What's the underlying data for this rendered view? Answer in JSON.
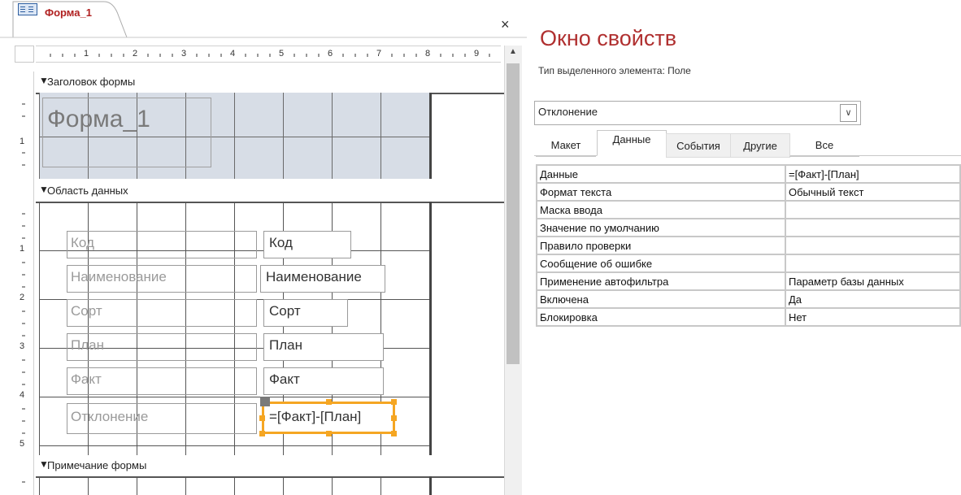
{
  "document_tab": {
    "title": "Форма_1",
    "close": "×"
  },
  "ruler": {
    "h_numbers": [
      "1",
      "2",
      "3",
      "4",
      "5",
      "6",
      "7",
      "8",
      "9"
    ],
    "v_numbers": [
      "1",
      "1",
      "2",
      "3",
      "4",
      "5"
    ]
  },
  "sections": {
    "header": "Заголовок формы",
    "detail": "Область данных",
    "footer": "Примечание формы"
  },
  "form_title": "Форма_1",
  "controls": [
    {
      "label": "Код",
      "field": "Код"
    },
    {
      "label": "Наименование",
      "field": "Наименование"
    },
    {
      "label": "Сорт",
      "field": "Сорт"
    },
    {
      "label": "План",
      "field": "План"
    },
    {
      "label": "Факт",
      "field": "Факт"
    },
    {
      "label": "Отклонение",
      "field": "=[Факт]-[План]"
    }
  ],
  "property_sheet": {
    "title": "Окно свойств",
    "selection_type": "Тип выделенного элемента:  Поле",
    "selected_object": "Отклонение",
    "tabs": [
      "Макет",
      "Данные",
      "События",
      "Другие",
      "Все"
    ],
    "active_tab": "Данные",
    "properties": [
      {
        "name": "Данные",
        "value": "=[Факт]-[План]"
      },
      {
        "name": "Формат текста",
        "value": "Обычный текст"
      },
      {
        "name": "Маска ввода",
        "value": ""
      },
      {
        "name": "Значение по умолчанию",
        "value": ""
      },
      {
        "name": "Правило проверки",
        "value": ""
      },
      {
        "name": "Сообщение об ошибке",
        "value": ""
      },
      {
        "name": "Применение автофильтра",
        "value": "Параметр базы данных"
      },
      {
        "name": "Включена",
        "value": "Да"
      },
      {
        "name": "Блокировка",
        "value": "Нет"
      }
    ]
  },
  "colors": {
    "accent": "#b03030",
    "selection": "#f5a623",
    "header_fill": "#d7dde6"
  }
}
